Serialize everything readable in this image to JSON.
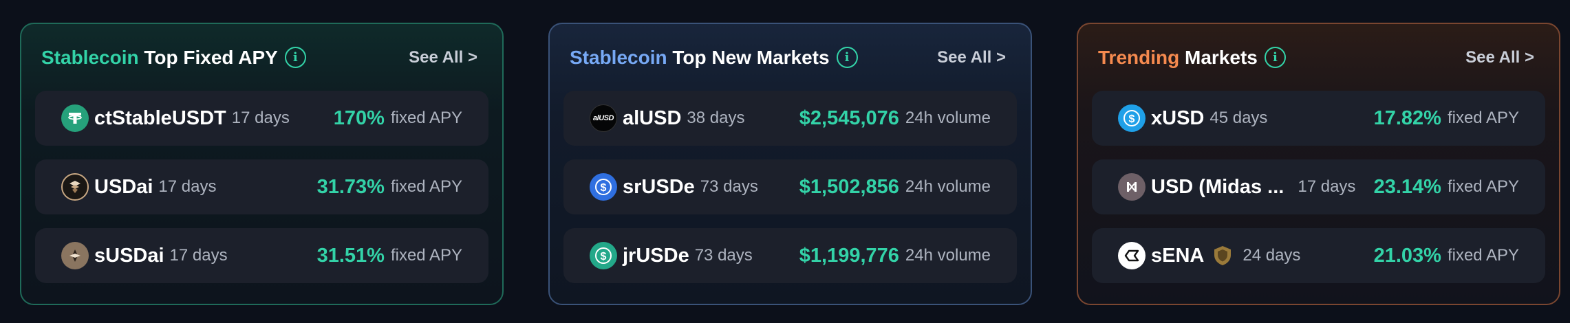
{
  "cards": [
    {
      "title_accent": "Stablecoin",
      "title_rest": "Top Fixed APY",
      "see_all": "See All >",
      "items": [
        {
          "name": "ctStableUSDT",
          "days": "17 days",
          "value": "170%",
          "unit": "fixed APY",
          "icon": "tether-coin-icon"
        },
        {
          "name": "USDai",
          "days": "17 days",
          "value": "31.73%",
          "unit": "fixed APY",
          "icon": "usdai-coin-icon"
        },
        {
          "name": "sUSDai",
          "days": "17 days",
          "value": "31.51%",
          "unit": "fixed APY",
          "icon": "susdai-coin-icon"
        }
      ]
    },
    {
      "title_accent": "Stablecoin",
      "title_rest": "Top New Markets",
      "see_all": "See All >",
      "items": [
        {
          "name": "alUSD",
          "days": "38 days",
          "value": "$2,545,076",
          "unit": "24h volume",
          "icon": "alusd-coin-icon",
          "icon_text": "alUSD"
        },
        {
          "name": "srUSDe",
          "days": "73 days",
          "value": "$1,502,856",
          "unit": "24h volume",
          "icon": "srusde-coin-icon"
        },
        {
          "name": "jrUSDe",
          "days": "73 days",
          "value": "$1,199,776",
          "unit": "24h volume",
          "icon": "jrusde-coin-icon"
        }
      ]
    },
    {
      "title_accent": "Trending",
      "title_rest": "Markets",
      "see_all": "See All >",
      "items": [
        {
          "name": "xUSD",
          "days": "45 days",
          "value": "17.82%",
          "unit": "fixed APY",
          "icon": "xusd-coin-icon"
        },
        {
          "name": "USD (Midas ...",
          "days": "17 days",
          "value": "23.14%",
          "unit": "fixed APY",
          "icon": "midas-coin-icon"
        },
        {
          "name": "sENA",
          "days": "24 days",
          "value": "21.03%",
          "unit": "fixed APY",
          "icon": "sena-coin-icon",
          "badge": "shield-icon"
        }
      ]
    }
  ],
  "colors": {
    "accent_green": "#33d3a8",
    "accent_blue": "#77a9f5",
    "accent_orange": "#f58a4f",
    "background": "#0c101a"
  }
}
